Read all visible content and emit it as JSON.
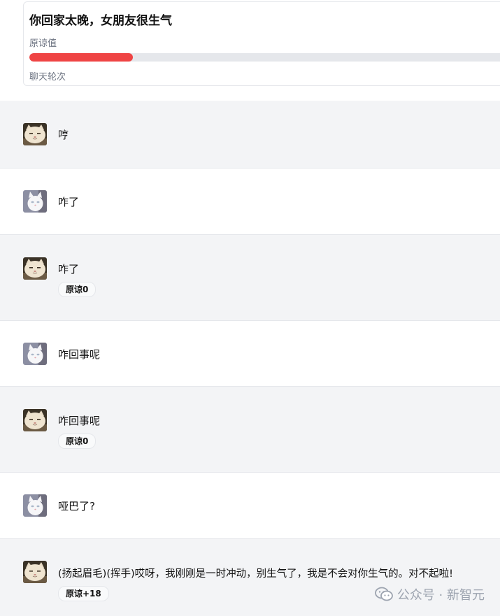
{
  "scenario": {
    "title": "你回家太晚，女朋友很生气",
    "forgiveness_label": "原谅值",
    "forgiveness_fraction": 0.215,
    "rounds_label": "聊天轮次"
  },
  "messages": [
    {
      "role": "ai",
      "text": "哼",
      "badge": ""
    },
    {
      "role": "user",
      "text": "咋了",
      "badge": ""
    },
    {
      "role": "ai",
      "text": "咋了",
      "badge": "原谅0"
    },
    {
      "role": "user",
      "text": "咋回事呢",
      "badge": ""
    },
    {
      "role": "ai",
      "text": "咋回事呢",
      "badge": "原谅0"
    },
    {
      "role": "user",
      "text": "哑巴了?",
      "badge": ""
    },
    {
      "role": "ai",
      "text": "(扬起眉毛)(挥手)哎呀，我刚刚是一时冲动，别生气了，我是不会对你生气的。对不起啦!",
      "badge": "原谅+18"
    }
  ],
  "avatars": {
    "ai": "cream-cat-avatar",
    "user": "white-cat-avatar"
  },
  "watermark": {
    "text": "公众号 · 新智元",
    "icon": "wechat-icon"
  },
  "colors": {
    "progress_fill": "#ef4444",
    "progress_track": "#e5e7eb",
    "ai_row_bg": "#f3f4f6",
    "user_row_bg": "#ffffff"
  }
}
